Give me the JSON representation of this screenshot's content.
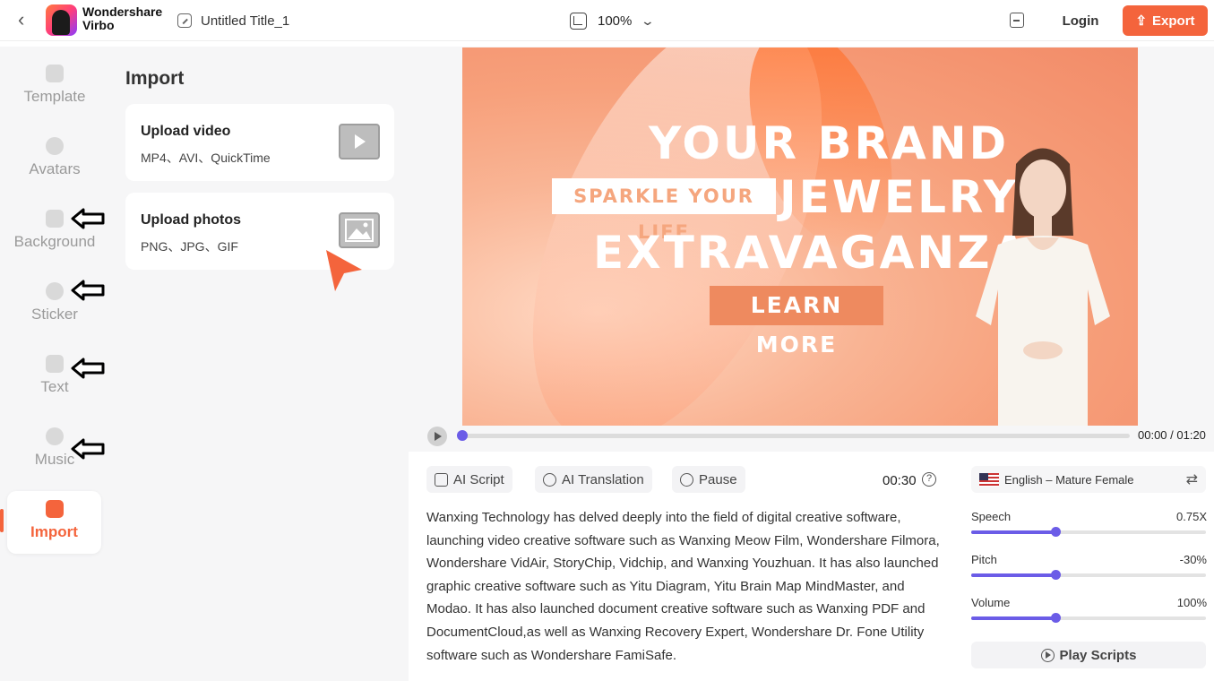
{
  "header": {
    "brand_line1": "Wondershare",
    "brand_line2": "Virbo",
    "doc_title": "Untitled Title_1",
    "zoom": "100%",
    "login_label": "Login",
    "export_label": "Export"
  },
  "sidebar": {
    "items": [
      {
        "label": "Template"
      },
      {
        "label": "Avatars"
      },
      {
        "label": "Background"
      },
      {
        "label": "Sticker"
      },
      {
        "label": "Text"
      },
      {
        "label": "Music"
      },
      {
        "label": "Import"
      }
    ]
  },
  "import_panel": {
    "title": "Import",
    "upload_video": {
      "title": "Upload video",
      "formats": "MP4、AVI、QuickTime"
    },
    "upload_photos": {
      "title": "Upload photos",
      "formats": "PNG、JPG、GIF"
    }
  },
  "canvas": {
    "line1": "YOUR BRAND",
    "line2": "JEWELRY",
    "line3": "EXTRAVAGANZA",
    "sparkle": "SPARKLE YOUR LIFE",
    "cta": "LEARN MORE"
  },
  "playback": {
    "time": "00:00 / 01:20",
    "progress": 0
  },
  "script": {
    "tools": {
      "ai_script": "AI Script",
      "ai_translation": "AI Translation",
      "pause": "Pause"
    },
    "duration": "00:30",
    "help_icon_text": "?",
    "text": "Wanxing Technology has delved deeply into the field of digital creative software, launching video creative software such as Wanxing Meow Film, Wondershare Filmora, Wondershare VidAir,   StoryChip, Vidchip, and Wanxing Youzhuan. It has also launched graphic creative software such as Yitu Diagram, Yitu Brain Map MindMaster, and Modao. It has also launched document creative software such as Wanxing PDF and DocumentCloud,as well as Wanxing Recovery Expert, Wondershare Dr. Fone Utility software such as Wondershare FamiSafe."
  },
  "voice": {
    "selected": "English – Mature Female",
    "speech": {
      "label": "Speech",
      "value": "0.75X",
      "level": 0.36
    },
    "pitch": {
      "label": "Pitch",
      "value": "-30%",
      "level": 0.36
    },
    "volume": {
      "label": "Volume",
      "value": "100%",
      "level": 0.36
    },
    "play_scripts": "Play Scripts"
  },
  "colors": {
    "accent": "#f4643c",
    "slider": "#6b5ce7"
  }
}
